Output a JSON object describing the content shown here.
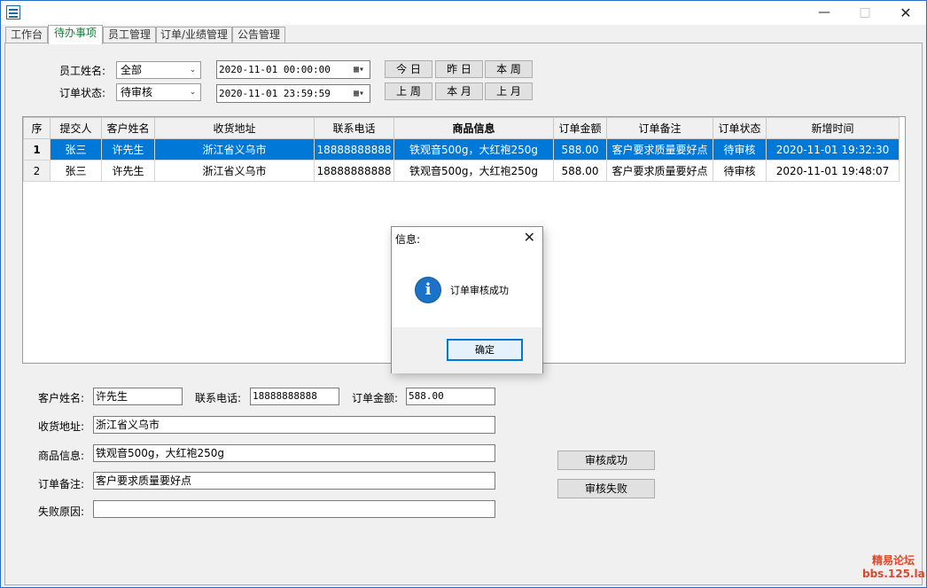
{
  "tabs": [
    "工作台",
    "待办事项",
    "员工管理",
    "订单/业绩管理",
    "公告管理"
  ],
  "filters": {
    "employee_label": "员工姓名:",
    "employee_value": "全部",
    "status_label": "订单状态:",
    "status_value": "待审核",
    "start_datetime": "2020-11-01 00:00:00",
    "end_datetime": "2020-11-01 23:59:59"
  },
  "quick_buttons": [
    "今 日",
    "昨 日",
    "本 周",
    "上 周",
    "本 月",
    "上 月"
  ],
  "table": {
    "columns": [
      "序",
      "提交人",
      "客户姓名",
      "收货地址",
      "联系电话",
      "商品信息",
      "订单金额",
      "订单备注",
      "订单状态",
      "新增时间"
    ],
    "rows": [
      [
        "1",
        "张三",
        "许先生",
        "浙江省义乌市",
        "18888888888",
        "铁观音500g，大红袍250g",
        "588.00",
        "客户要求质量要好点",
        "待审核",
        "2020-11-01 19:32:30"
      ],
      [
        "2",
        "张三",
        "许先生",
        "浙江省义乌市",
        "18888888888",
        "铁观音500g，大红袍250g",
        "588.00",
        "客户要求质量要好点",
        "待审核",
        "2020-11-01 19:48:07"
      ]
    ]
  },
  "detail": {
    "customer_label": "客户姓名:",
    "customer_value": "许先生",
    "phone_label": "联系电话:",
    "phone_value": "18888888888",
    "amount_label": "订单金额:",
    "amount_value": "588.00",
    "address_label": "收货地址:",
    "address_value": "浙江省义乌市",
    "goods_label": "商品信息:",
    "goods_value": "铁观音500g，大红袍250g",
    "remark_label": "订单备注:",
    "remark_value": "客户要求质量要好点",
    "fail_label": "失败原因:",
    "fail_value": ""
  },
  "actions": {
    "approve": "审核成功",
    "reject": "审核失败"
  },
  "dialog": {
    "title": "信息:",
    "message": "订单审核成功",
    "ok": "确定"
  },
  "watermark": {
    "line1": "精易论坛",
    "line2": "bbs.125.la"
  },
  "colors": {
    "selection": "#0078d7",
    "active_tab_text": "#11803a",
    "info_icon": "#1a73c7"
  }
}
